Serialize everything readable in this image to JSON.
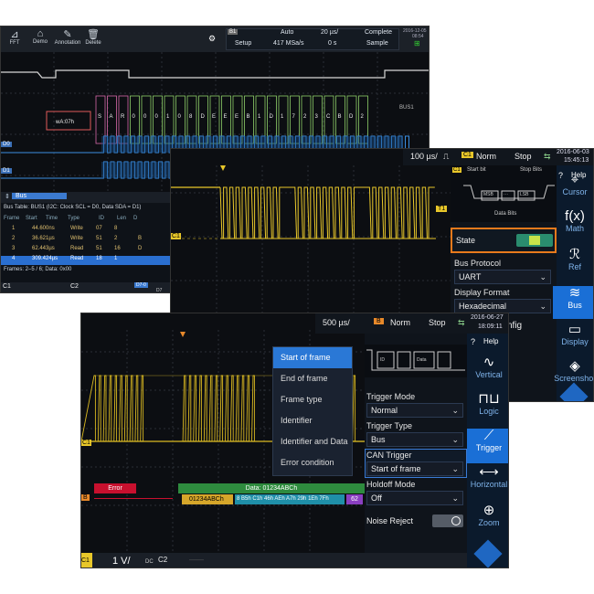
{
  "screen1": {
    "toolbar": {
      "fft": "FFT",
      "demo": "Demo",
      "annotation": "Annotation",
      "delete": "Delete",
      "bus_tag": "B1",
      "auto": "Auto",
      "timebase": "20 µs/",
      "complete": "Complete",
      "date": "2016-12-05",
      "time": "08:54",
      "setup": "Setup",
      "rate": "417 MSa/s",
      "offset": "0 s",
      "sample": "Sample"
    },
    "decode_labels": [
      "wA:07h",
      "S",
      "A",
      "R",
      "0",
      "0",
      "0",
      "1",
      "0",
      "8",
      "D",
      "E",
      "E",
      "E",
      "B",
      "1",
      "D",
      "1",
      "7",
      "2",
      "3",
      "C",
      "B",
      "D",
      "2"
    ],
    "bus_label": "BUS1",
    "channel_labels": {
      "d0": "D0",
      "d1": "D1"
    },
    "bus_tab": "Bus",
    "table_title": "Bus Table: BUS1 (I2C: Clock SCL = D0, Data SDA = D1)",
    "columns": [
      "Frame",
      "Start",
      "Time",
      "Type",
      "ID",
      "Len",
      "D"
    ],
    "rows": [
      [
        "1",
        "44.600ns",
        "Write",
        "07",
        "8"
      ],
      [
        "2",
        "36.621µs",
        "Write",
        "51",
        "2",
        "B"
      ],
      [
        "3",
        "62.443µs",
        "Read",
        "51",
        "16",
        "D"
      ],
      [
        "4",
        "309.424µs",
        "Read",
        "18",
        "1"
      ]
    ],
    "footer": "Frames: 2–5 / 6; Data: 0x00",
    "bottom": {
      "c1": "C1",
      "c2": "C2",
      "d7": "D7-0",
      "d7b": "D7"
    }
  },
  "screen2": {
    "timebase": "100 µs/",
    "trig_ch": "C1",
    "norm": "Norm",
    "stop": "Stop",
    "date": "2016-06-03",
    "time": "15:45:13",
    "help": "Help",
    "frame_diagram": {
      "start": "Start bit",
      "stop": "Stop Bits",
      "msb": "MSB",
      "dots": "···",
      "lsb": "LSB",
      "data": "Data Bits"
    },
    "state_label": "State",
    "bus_protocol_label": "Bus Protocol",
    "bus_protocol": "UART",
    "display_format_label": "Display Format",
    "display_format": "Hexadecimal",
    "config_label": "nfig",
    "nav": [
      {
        "label": "Cursor",
        "icon": "⌖"
      },
      {
        "label": "Math",
        "icon": "f(x)"
      },
      {
        "label": "Ref",
        "icon": "ℛ"
      },
      {
        "label": "Bus",
        "icon": "≋"
      },
      {
        "label": "Display",
        "icon": "▭"
      },
      {
        "label": "Screenshot",
        "icon": "◈"
      }
    ],
    "markers": {
      "c1": "C1",
      "t1": "T1"
    }
  },
  "screen3": {
    "timebase": "500 µs/",
    "trig_ch": "B",
    "norm": "Norm",
    "stop": "Stop",
    "date": "2016-06-27",
    "time": "18:09:11",
    "help": "Help",
    "menu": [
      "Start of frame",
      "End of frame",
      "Frame type",
      "Identifier",
      "Identifier and Data",
      "Error condition"
    ],
    "trigger_mode_label": "Trigger Mode",
    "trigger_mode": "Normal",
    "trigger_type_label": "Trigger Type",
    "trigger_type": "Bus",
    "can_trigger_label": "CAN Trigger",
    "can_trigger": "Start of frame",
    "holdoff_label": "Holdoff Mode",
    "holdoff": "Off",
    "noise_label": "Noise Reject",
    "frame_fields": {
      "id": "ID",
      "data": "Data"
    },
    "nav": [
      {
        "label": "Vertical",
        "icon": "∿"
      },
      {
        "label": "Logic",
        "icon": "⊓⊔"
      },
      {
        "label": "Trigger",
        "icon": "⟋"
      },
      {
        "label": "Horizontal",
        "icon": "⟷"
      },
      {
        "label": "Zoom",
        "icon": "⊕"
      }
    ],
    "error_label": "Error",
    "data_label": "Data: 01234ABCh",
    "decode_id": "01234ABCh",
    "decode_bytes": "8 B5h C1h 46h AEh A7h 29h 1Eh 7Fh",
    "decode_crc": "62",
    "markers": {
      "c1": "C1",
      "b": "B"
    },
    "bottom": {
      "c1": "C1",
      "vdiv": "1 V/",
      "dc": "DC",
      "c2": "C2",
      "dash": "——"
    }
  }
}
